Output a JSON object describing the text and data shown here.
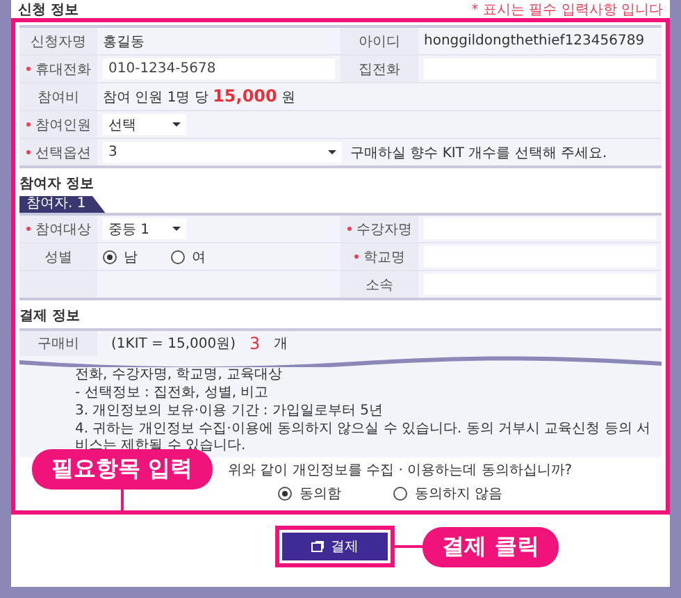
{
  "section_title": "신청 정보",
  "required_note": "* 표시는 필수 입력사항 입니다",
  "applicant_rows": [
    [
      {
        "kind": "label",
        "text": "신청자명",
        "required": false
      },
      {
        "kind": "text",
        "text": "홍길동"
      },
      {
        "kind": "label",
        "text": "아이디",
        "required": false
      },
      {
        "kind": "text",
        "text": "honggildongthethief123456789"
      }
    ],
    [
      {
        "kind": "label",
        "text": "휴대전화",
        "required": true
      },
      {
        "kind": "input",
        "value": "010-1234-5678"
      },
      {
        "kind": "label",
        "text": "집전화",
        "required": false
      },
      {
        "kind": "input"
      }
    ],
    [
      {
        "kind": "label",
        "text": "참여비",
        "required": false
      },
      {
        "kind": "rich",
        "text": "참여 인원 1명 당 **15,000** 원"
      }
    ],
    [
      {
        "kind": "label",
        "text": "참여인원",
        "required": true
      },
      {
        "kind": "select",
        "value": "선택"
      }
    ],
    [
      {
        "kind": "label",
        "text": "선택옵션",
        "required": true
      },
      {
        "kind": "select",
        "value": "3",
        "hint": "구매하실 향수 KIT 개수를 선택해 주세요."
      }
    ]
  ],
  "participant": {
    "title": "참여자 정보",
    "tabs": [
      {
        "label": "참여자. 1",
        "selected": true
      }
    ],
    "rows": [
      [
        {
          "kind": "label",
          "text": "참여대상",
          "required": true
        },
        {
          "kind": "select",
          "value": "중등 1"
        },
        {
          "kind": "label",
          "text": "수강자명",
          "required": true
        },
        {
          "kind": "input"
        }
      ],
      [
        {
          "kind": "label",
          "text": "성별",
          "required": false
        },
        {
          "kind": "radios",
          "options": [
            {
              "label": "남",
              "selected": true
            },
            {
              "label": "여",
              "selected": false
            }
          ]
        },
        {
          "kind": "label",
          "text": "학교명",
          "required": true
        },
        {
          "kind": "input"
        }
      ],
      [
        {
          "kind": "blank"
        },
        {
          "kind": "blank"
        },
        {
          "kind": "label",
          "text": "소속",
          "required": false
        },
        {
          "kind": "input"
        }
      ]
    ]
  },
  "payment": {
    "title": "결제 정보",
    "label": "구매비",
    "unit_price": "(1KIT = 15,000원)",
    "count": "3",
    "count_unit": "개",
    "privacy_lines": [
      "전화, 수강자명, 학교명, 교육대상",
      "- 선택정보 : 집전화, 성별, 비고",
      "3. 개인정보의 보유·이용 기간 : 가입일로부터 5년",
      "4. 귀하는 개인정보 수집·이용에 동의하지 않으실 수 있습니다. 동의 거부시 교육신청 등의 서비스는 제한될 수 있습니다."
    ],
    "question": "위와 같이 개인정보를 수집 · 이용하는데 동의하십니까?",
    "consent": [
      {
        "label": "동의함",
        "selected": true
      },
      {
        "label": "동의하지 않음",
        "selected": false
      }
    ]
  },
  "pay_button": "결제",
  "callouts": [
    {
      "text": "필요항목 입력"
    },
    {
      "text": "결제 클릭"
    }
  ]
}
